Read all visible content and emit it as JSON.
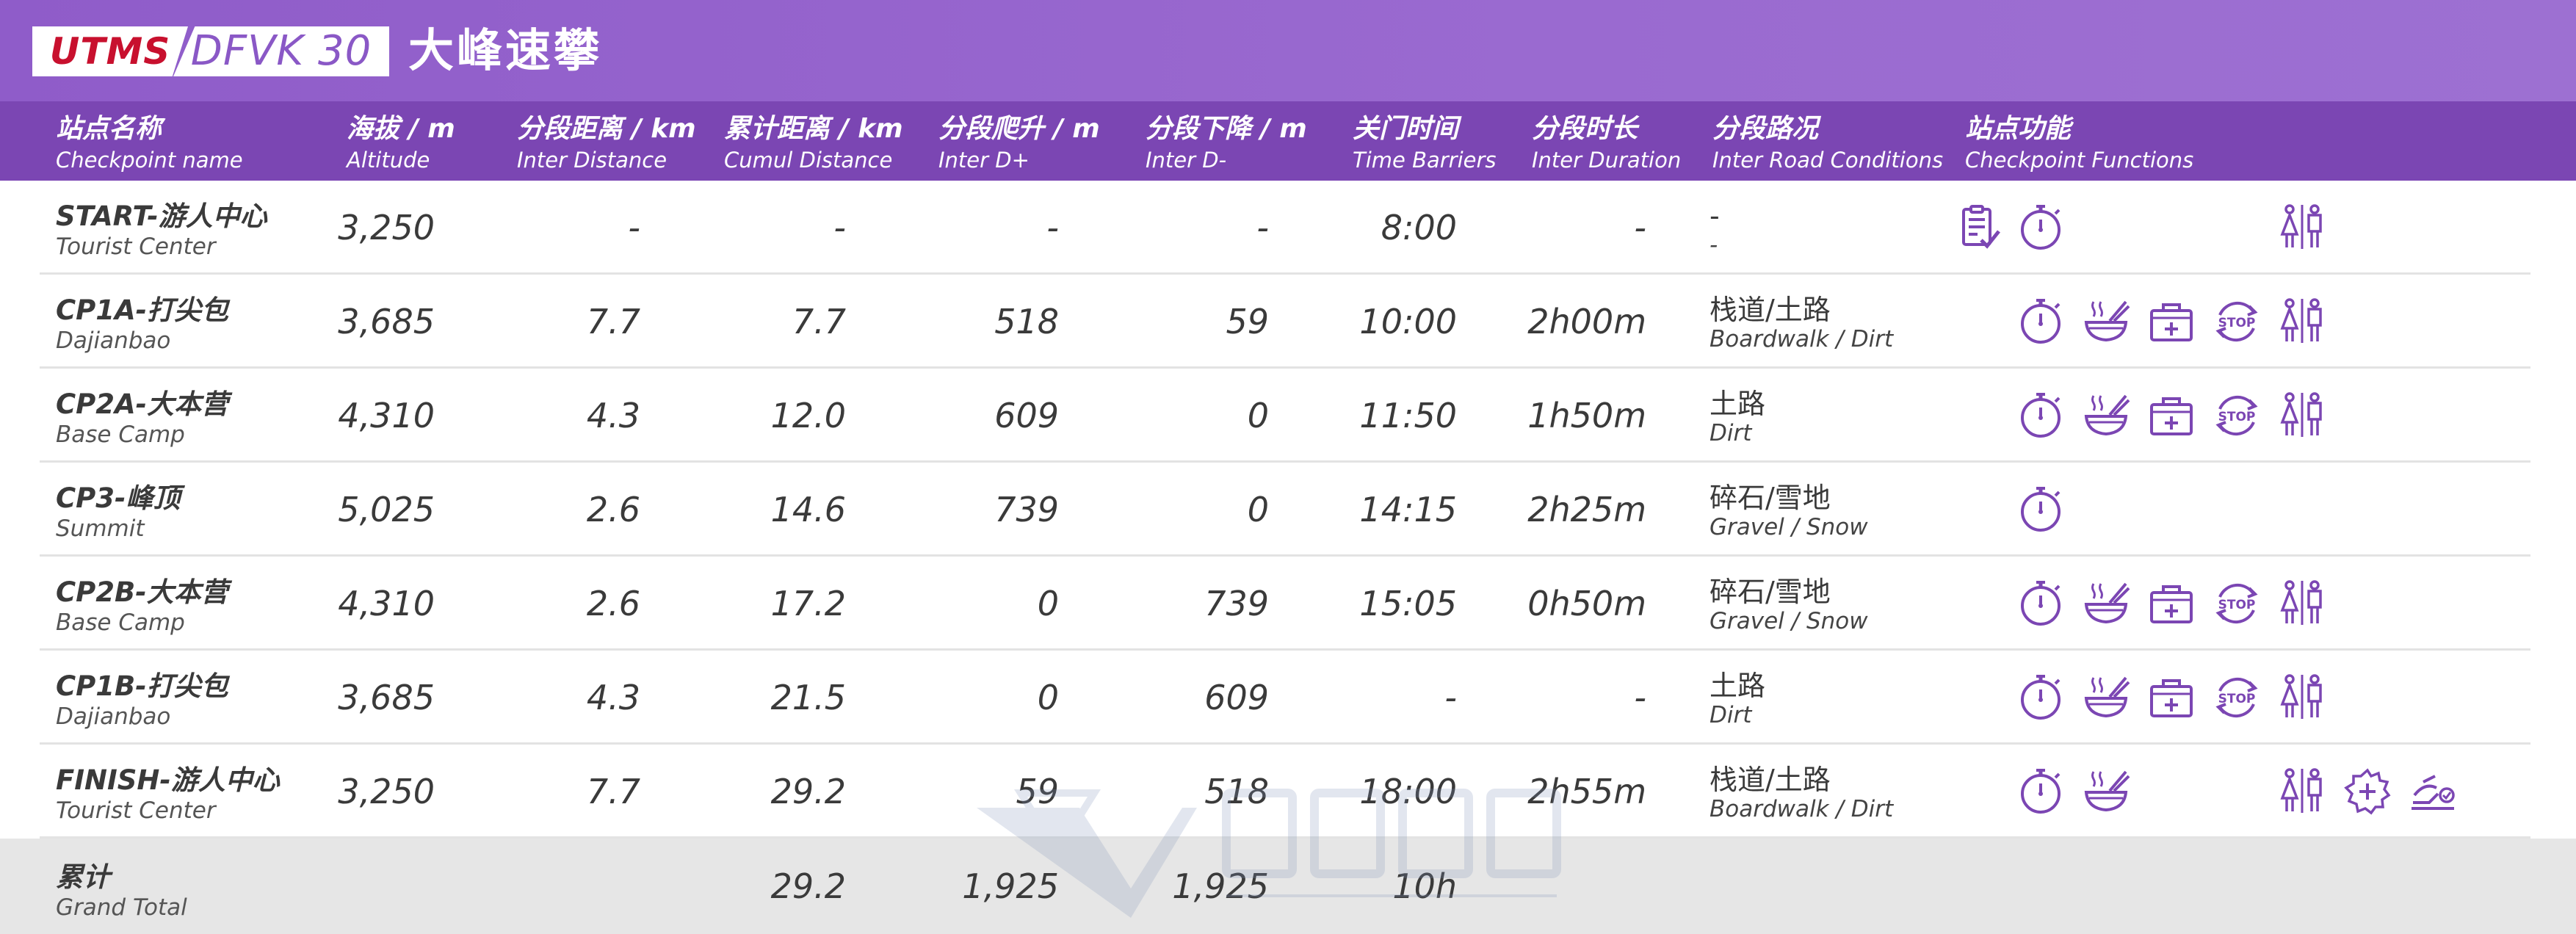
{
  "title": {
    "brand": "UTMS",
    "race": "DFVK 30",
    "name_cn": "大峰速攀"
  },
  "headers": [
    {
      "key": "name",
      "cn": "站点名称",
      "en": "Checkpoint name"
    },
    {
      "key": "alt",
      "cn": "海拔 / m",
      "en": "Altitude"
    },
    {
      "key": "inter_dist",
      "cn": "分段距离 / km",
      "en": "Inter Distance"
    },
    {
      "key": "cumul_dist",
      "cn": "累计距离 / km",
      "en": "Cumul Distance"
    },
    {
      "key": "d_plus",
      "cn": "分段爬升 / m",
      "en": "Inter D+"
    },
    {
      "key": "d_minus",
      "cn": "分段下降 / m",
      "en": "Inter D-"
    },
    {
      "key": "barrier",
      "cn": "关门时间",
      "en": "Time Barriers"
    },
    {
      "key": "duration",
      "cn": "分段时长",
      "en": "Inter Duration"
    },
    {
      "key": "road",
      "cn": "分段路况",
      "en": "Inter Road Conditions"
    },
    {
      "key": "functions",
      "cn": "站点功能",
      "en": "Checkpoint Functions"
    }
  ],
  "rows": [
    {
      "name_cn": "START-游人中心",
      "name_en": "Tourist Center",
      "alt": "3,250",
      "inter_dist": "-",
      "cumul_dist": "-",
      "d_plus": "-",
      "d_minus": "-",
      "barrier": "8:00",
      "duration": "-",
      "road_cn": "-",
      "road_en": "-",
      "icons": [
        "checklist-icon",
        "timing-icon",
        "toilet-icon"
      ]
    },
    {
      "name_cn": "CP1A-打尖包",
      "name_en": "Dajianbao",
      "alt": "3,685",
      "inter_dist": "7.7",
      "cumul_dist": "7.7",
      "d_plus": "518",
      "d_minus": "59",
      "barrier": "10:00",
      "duration": "2h00m",
      "road_cn": "栈道/土路",
      "road_en": "Boardwalk / Dirt",
      "icons": [
        "timing-icon",
        "food-icon",
        "medical-icon",
        "stop-icon",
        "toilet-icon"
      ]
    },
    {
      "name_cn": "CP2A-大本营",
      "name_en": "Base Camp",
      "alt": "4,310",
      "inter_dist": "4.3",
      "cumul_dist": "12.0",
      "d_plus": "609",
      "d_minus": "0",
      "barrier": "11:50",
      "duration": "1h50m",
      "road_cn": "土路",
      "road_en": "Dirt",
      "icons": [
        "timing-icon",
        "food-icon",
        "medical-icon",
        "stop-icon",
        "toilet-icon"
      ]
    },
    {
      "name_cn": "CP3-峰顶",
      "name_en": "Summit",
      "alt": "5,025",
      "inter_dist": "2.6",
      "cumul_dist": "14.6",
      "d_plus": "739",
      "d_minus": "0",
      "barrier": "14:15",
      "duration": "2h25m",
      "road_cn": "碎石/雪地",
      "road_en": "Gravel / Snow",
      "icons": [
        "timing-icon"
      ]
    },
    {
      "name_cn": "CP2B-大本营",
      "name_en": "Base Camp",
      "alt": "4,310",
      "inter_dist": "2.6",
      "cumul_dist": "17.2",
      "d_plus": "0",
      "d_minus": "739",
      "barrier": "15:05",
      "duration": "0h50m",
      "road_cn": "碎石/雪地",
      "road_en": "Gravel / Snow",
      "icons": [
        "timing-icon",
        "food-icon",
        "medical-icon",
        "stop-icon",
        "toilet-icon"
      ]
    },
    {
      "name_cn": "CP1B-打尖包",
      "name_en": "Dajianbao",
      "alt": "3,685",
      "inter_dist": "4.3",
      "cumul_dist": "21.5",
      "d_plus": "0",
      "d_minus": "609",
      "barrier": "-",
      "duration": "-",
      "road_cn": "土路",
      "road_en": "Dirt",
      "icons": [
        "timing-icon",
        "food-icon",
        "medical-icon",
        "stop-icon",
        "toilet-icon"
      ]
    },
    {
      "name_cn": "FINISH-游人中心",
      "name_en": "Tourist Center",
      "alt": "3,250",
      "inter_dist": "7.7",
      "cumul_dist": "29.2",
      "d_plus": "59",
      "d_minus": "518",
      "barrier": "18:00",
      "duration": "2h55m",
      "road_cn": "栈道/土路",
      "road_en": "Boardwalk / Dirt",
      "icons": [
        "timing-icon",
        "food-icon",
        "toilet-icon",
        "first-aid-icon",
        "finish-icon"
      ]
    }
  ],
  "total": {
    "name_cn": "累计",
    "name_en": "Grand Total",
    "cumul_dist": "29.2",
    "d_plus": "1,925",
    "d_minus": "1,925",
    "barrier": "10h"
  },
  "colors": {
    "title_bg": "#9a6ad0",
    "header_bg": "#7b46b3",
    "icon_stroke": "#7b46b3",
    "total_bg": "#e6e6e6",
    "brand_red": "#c8102e"
  }
}
